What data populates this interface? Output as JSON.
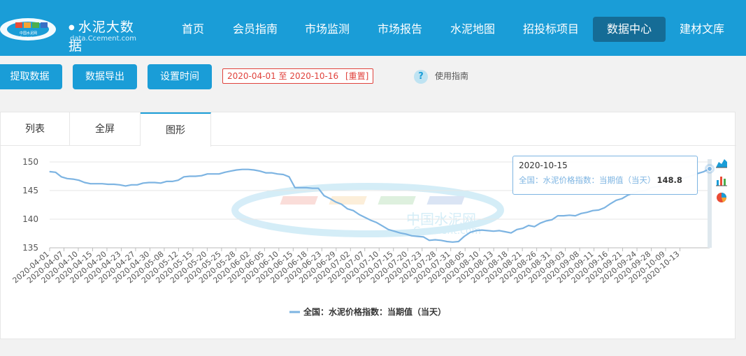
{
  "logo": {
    "cn": "水泥大数据",
    "en": "data.Ccement.com",
    "badge_top": "中国水泥网",
    "badge_bottom": "Ccement.com"
  },
  "nav": [
    "首页",
    "会员指南",
    "市场监测",
    "市场报告",
    "水泥地图",
    "招投标项目",
    "数据中心",
    "建材文库"
  ],
  "nav_active": "数据中心",
  "toolbar": {
    "fetch_label": "提取数据",
    "export_label": "数据导出",
    "time_label": "设置时间",
    "date_range": "2020-04-01 至 2020-10-16",
    "reset_label": "[重置]",
    "help_label": "使用指南"
  },
  "tabs": [
    "列表",
    "全屏",
    "图形"
  ],
  "active_tab": "图形",
  "tooltip": {
    "date": "2020-10-15",
    "series": "全国：水泥价格指数：当期值（当天）",
    "value": "148.8"
  },
  "watermark": {
    "cn": "中国水泥网",
    "en": "Ccement.com"
  },
  "side_icons": [
    "area-chart-icon",
    "bar-chart-icon",
    "pie-chart-icon"
  ],
  "colors": {
    "brand": "#1a9dd7",
    "line": "#7db4e2",
    "danger": "#e0423c"
  },
  "chart_data": {
    "type": "line",
    "ylim": [
      135,
      150
    ],
    "yticks": [
      135,
      140,
      145,
      150
    ],
    "xticks": [
      "2020-04-01",
      "2020-04-07",
      "2020-04-10",
      "2020-04-15",
      "2020-04-20",
      "2020-04-23",
      "2020-04-27",
      "2020-04-30",
      "2020-05-08",
      "2020-05-12",
      "2020-05-15",
      "2020-05-20",
      "2020-05-25",
      "2020-05-28",
      "2020-06-02",
      "2020-06-05",
      "2020-06-10",
      "2020-06-15",
      "2020-06-18",
      "2020-06-23",
      "2020-06-29",
      "2020-07-02",
      "2020-07-07",
      "2020-07-10",
      "2020-07-15",
      "2020-07-20",
      "2020-07-23",
      "2020-07-28",
      "2020-07-31",
      "2020-08-05",
      "2020-08-10",
      "2020-08-13",
      "2020-08-18",
      "2020-08-21",
      "2020-08-26",
      "2020-08-31",
      "2020-09-03",
      "2020-09-08",
      "2020-09-11",
      "2020-09-16",
      "2020-09-21",
      "2020-09-24",
      "2020-09-28",
      "2020-10-09",
      "2020-10-13"
    ],
    "series": [
      {
        "name": "全国：水泥价格指数：当期值（当天）",
        "values": [
          148.3,
          148.2,
          147.4,
          147.1,
          147.0,
          146.8,
          146.4,
          146.2,
          146.2,
          146.2,
          146.1,
          146.1,
          146.0,
          145.8,
          146.0,
          146.0,
          146.3,
          146.4,
          146.4,
          146.3,
          146.6,
          146.6,
          146.8,
          147.4,
          147.5,
          147.5,
          147.6,
          147.9,
          147.9,
          147.9,
          148.2,
          148.4,
          148.6,
          148.7,
          148.7,
          148.6,
          148.4,
          148.1,
          148.1,
          147.9,
          147.8,
          147.4,
          145.5,
          145.5,
          145.5,
          145.4,
          145.4,
          144.1,
          143.6,
          143.0,
          142.6,
          141.8,
          141.5,
          140.8,
          140.3,
          139.8,
          139.4,
          138.8,
          138.2,
          137.9,
          137.6,
          137.4,
          137.1,
          137.0,
          136.9,
          136.3,
          136.4,
          136.3,
          136.1,
          136.0,
          136.1,
          137.0,
          137.7,
          138.0,
          138.1,
          138.0,
          137.9,
          138.0,
          137.8,
          137.6,
          138.2,
          138.4,
          138.9,
          138.7,
          139.3,
          139.7,
          139.9,
          140.6,
          140.6,
          140.7,
          140.6,
          141.0,
          141.2,
          141.5,
          141.6,
          142.0,
          142.7,
          143.3,
          143.6,
          144.2,
          144.6,
          144.9,
          145.0,
          145.5,
          145.7,
          145.8,
          146.3,
          146.7,
          146.9,
          147.3,
          147.6,
          148.0,
          148.3,
          148.8
        ]
      }
    ]
  }
}
